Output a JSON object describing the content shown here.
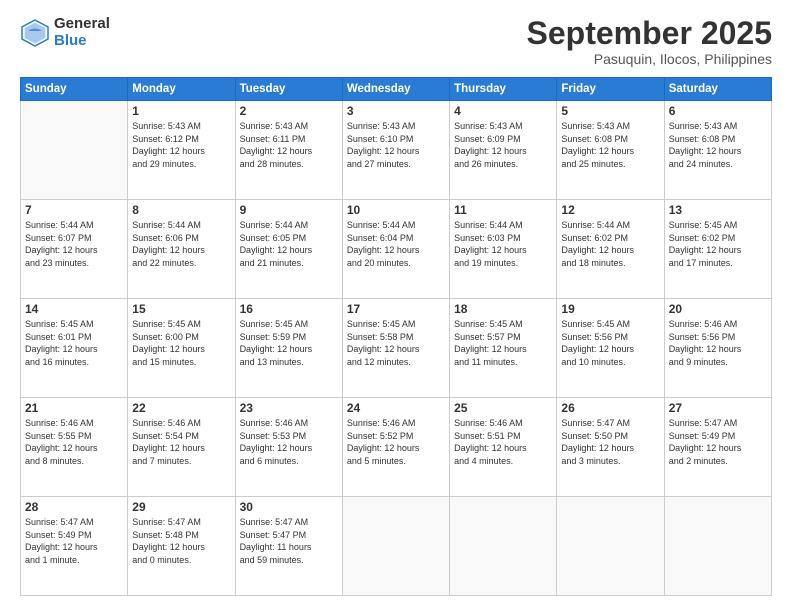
{
  "header": {
    "logo_general": "General",
    "logo_blue": "Blue",
    "month_title": "September 2025",
    "subtitle": "Pasuquin, Ilocos, Philippines"
  },
  "days_of_week": [
    "Sunday",
    "Monday",
    "Tuesday",
    "Wednesday",
    "Thursday",
    "Friday",
    "Saturday"
  ],
  "weeks": [
    [
      {
        "day": "",
        "info": ""
      },
      {
        "day": "1",
        "info": "Sunrise: 5:43 AM\nSunset: 6:12 PM\nDaylight: 12 hours\nand 29 minutes."
      },
      {
        "day": "2",
        "info": "Sunrise: 5:43 AM\nSunset: 6:11 PM\nDaylight: 12 hours\nand 28 minutes."
      },
      {
        "day": "3",
        "info": "Sunrise: 5:43 AM\nSunset: 6:10 PM\nDaylight: 12 hours\nand 27 minutes."
      },
      {
        "day": "4",
        "info": "Sunrise: 5:43 AM\nSunset: 6:09 PM\nDaylight: 12 hours\nand 26 minutes."
      },
      {
        "day": "5",
        "info": "Sunrise: 5:43 AM\nSunset: 6:08 PM\nDaylight: 12 hours\nand 25 minutes."
      },
      {
        "day": "6",
        "info": "Sunrise: 5:43 AM\nSunset: 6:08 PM\nDaylight: 12 hours\nand 24 minutes."
      }
    ],
    [
      {
        "day": "7",
        "info": "Sunrise: 5:44 AM\nSunset: 6:07 PM\nDaylight: 12 hours\nand 23 minutes."
      },
      {
        "day": "8",
        "info": "Sunrise: 5:44 AM\nSunset: 6:06 PM\nDaylight: 12 hours\nand 22 minutes."
      },
      {
        "day": "9",
        "info": "Sunrise: 5:44 AM\nSunset: 6:05 PM\nDaylight: 12 hours\nand 21 minutes."
      },
      {
        "day": "10",
        "info": "Sunrise: 5:44 AM\nSunset: 6:04 PM\nDaylight: 12 hours\nand 20 minutes."
      },
      {
        "day": "11",
        "info": "Sunrise: 5:44 AM\nSunset: 6:03 PM\nDaylight: 12 hours\nand 19 minutes."
      },
      {
        "day": "12",
        "info": "Sunrise: 5:44 AM\nSunset: 6:02 PM\nDaylight: 12 hours\nand 18 minutes."
      },
      {
        "day": "13",
        "info": "Sunrise: 5:45 AM\nSunset: 6:02 PM\nDaylight: 12 hours\nand 17 minutes."
      }
    ],
    [
      {
        "day": "14",
        "info": "Sunrise: 5:45 AM\nSunset: 6:01 PM\nDaylight: 12 hours\nand 16 minutes."
      },
      {
        "day": "15",
        "info": "Sunrise: 5:45 AM\nSunset: 6:00 PM\nDaylight: 12 hours\nand 15 minutes."
      },
      {
        "day": "16",
        "info": "Sunrise: 5:45 AM\nSunset: 5:59 PM\nDaylight: 12 hours\nand 13 minutes."
      },
      {
        "day": "17",
        "info": "Sunrise: 5:45 AM\nSunset: 5:58 PM\nDaylight: 12 hours\nand 12 minutes."
      },
      {
        "day": "18",
        "info": "Sunrise: 5:45 AM\nSunset: 5:57 PM\nDaylight: 12 hours\nand 11 minutes."
      },
      {
        "day": "19",
        "info": "Sunrise: 5:45 AM\nSunset: 5:56 PM\nDaylight: 12 hours\nand 10 minutes."
      },
      {
        "day": "20",
        "info": "Sunrise: 5:46 AM\nSunset: 5:56 PM\nDaylight: 12 hours\nand 9 minutes."
      }
    ],
    [
      {
        "day": "21",
        "info": "Sunrise: 5:46 AM\nSunset: 5:55 PM\nDaylight: 12 hours\nand 8 minutes."
      },
      {
        "day": "22",
        "info": "Sunrise: 5:46 AM\nSunset: 5:54 PM\nDaylight: 12 hours\nand 7 minutes."
      },
      {
        "day": "23",
        "info": "Sunrise: 5:46 AM\nSunset: 5:53 PM\nDaylight: 12 hours\nand 6 minutes."
      },
      {
        "day": "24",
        "info": "Sunrise: 5:46 AM\nSunset: 5:52 PM\nDaylight: 12 hours\nand 5 minutes."
      },
      {
        "day": "25",
        "info": "Sunrise: 5:46 AM\nSunset: 5:51 PM\nDaylight: 12 hours\nand 4 minutes."
      },
      {
        "day": "26",
        "info": "Sunrise: 5:47 AM\nSunset: 5:50 PM\nDaylight: 12 hours\nand 3 minutes."
      },
      {
        "day": "27",
        "info": "Sunrise: 5:47 AM\nSunset: 5:49 PM\nDaylight: 12 hours\nand 2 minutes."
      }
    ],
    [
      {
        "day": "28",
        "info": "Sunrise: 5:47 AM\nSunset: 5:49 PM\nDaylight: 12 hours\nand 1 minute."
      },
      {
        "day": "29",
        "info": "Sunrise: 5:47 AM\nSunset: 5:48 PM\nDaylight: 12 hours\nand 0 minutes."
      },
      {
        "day": "30",
        "info": "Sunrise: 5:47 AM\nSunset: 5:47 PM\nDaylight: 11 hours\nand 59 minutes."
      },
      {
        "day": "",
        "info": ""
      },
      {
        "day": "",
        "info": ""
      },
      {
        "day": "",
        "info": ""
      },
      {
        "day": "",
        "info": ""
      }
    ]
  ]
}
